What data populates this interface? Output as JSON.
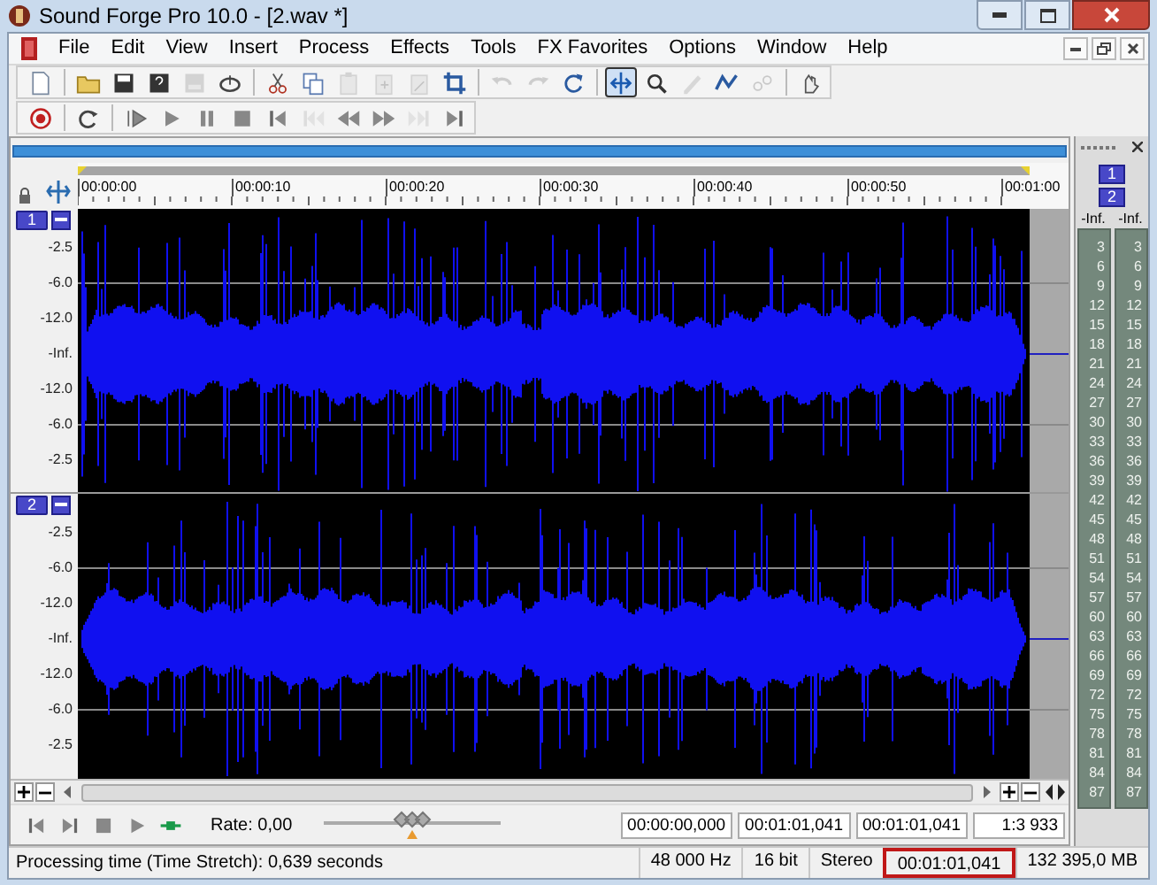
{
  "window": {
    "title": "Sound Forge Pro 10.0 - [2.wav *]"
  },
  "menu": [
    "File",
    "Edit",
    "View",
    "Insert",
    "Process",
    "Effects",
    "Tools",
    "FX Favorites",
    "Options",
    "Window",
    "Help"
  ],
  "toolbar_1": [
    [
      {
        "kind": "new",
        "disabled": false,
        "selected": false
      }
    ],
    [
      {
        "kind": "open",
        "disabled": false,
        "selected": false
      },
      {
        "kind": "save",
        "disabled": false,
        "selected": false
      },
      {
        "kind": "save_as",
        "disabled": false,
        "selected": false
      },
      {
        "kind": "render",
        "disabled": true,
        "selected": false
      },
      {
        "kind": "properties",
        "disabled": false,
        "selected": false
      }
    ],
    [
      {
        "kind": "cut",
        "disabled": false,
        "selected": false
      },
      {
        "kind": "copy",
        "disabled": false,
        "selected": false
      },
      {
        "kind": "paste",
        "disabled": true,
        "selected": false
      },
      {
        "kind": "mix",
        "disabled": true,
        "selected": false
      },
      {
        "kind": "crossfade",
        "disabled": true,
        "selected": false
      },
      {
        "kind": "trim",
        "disabled": false,
        "selected": false
      }
    ],
    [
      {
        "kind": "undo",
        "disabled": true,
        "selected": false
      },
      {
        "kind": "redo",
        "disabled": true,
        "selected": false
      },
      {
        "kind": "repeat",
        "disabled": false,
        "selected": false
      }
    ],
    [
      {
        "kind": "edit_tool",
        "disabled": false,
        "selected": true
      },
      {
        "kind": "magnify",
        "disabled": false,
        "selected": false
      },
      {
        "kind": "pencil",
        "disabled": true,
        "selected": false
      },
      {
        "kind": "envelope",
        "disabled": false,
        "selected": false
      },
      {
        "kind": "event",
        "disabled": true,
        "selected": false
      }
    ],
    [
      {
        "kind": "plugin",
        "disabled": false,
        "selected": false
      }
    ]
  ],
  "toolbar_2": [
    [
      {
        "kind": "record",
        "disabled": false
      }
    ],
    [
      {
        "kind": "loop",
        "disabled": false
      }
    ],
    [
      {
        "kind": "play_all",
        "disabled": false
      },
      {
        "kind": "play",
        "disabled": false
      },
      {
        "kind": "pause",
        "disabled": false
      },
      {
        "kind": "stop",
        "disabled": false
      },
      {
        "kind": "go_start",
        "disabled": false
      },
      {
        "kind": "prev",
        "disabled": true
      },
      {
        "kind": "rewind",
        "disabled": false
      },
      {
        "kind": "forward",
        "disabled": false
      },
      {
        "kind": "next",
        "disabled": true
      },
      {
        "kind": "go_end",
        "disabled": false
      }
    ]
  ],
  "ruler": {
    "labels": [
      "00:00:00",
      "00:00:10",
      "00:00:20",
      "00:00:30",
      "00:00:40",
      "00:00:50",
      "00:01:00"
    ]
  },
  "channels": [
    {
      "number": "1",
      "scale": [
        "-2.5",
        "-6.0",
        "-12.0",
        "-Inf.",
        "-12.0",
        "-6.0",
        "-2.5"
      ]
    },
    {
      "number": "2",
      "scale": [
        "-2.5",
        "-6.0",
        "-12.0",
        "-Inf.",
        "-12.0",
        "-6.0",
        "-2.5"
      ]
    }
  ],
  "meters": [
    {
      "number": "1",
      "peak": "-Inf.",
      "scale": [
        "3",
        "6",
        "9",
        "12",
        "15",
        "18",
        "21",
        "24",
        "27",
        "30",
        "33",
        "36",
        "39",
        "42",
        "45",
        "48",
        "51",
        "54",
        "57",
        "60",
        "63",
        "66",
        "69",
        "72",
        "75",
        "78",
        "81",
        "84",
        "87"
      ]
    },
    {
      "number": "2",
      "peak": "-Inf.",
      "scale": [
        "3",
        "6",
        "9",
        "12",
        "15",
        "18",
        "21",
        "24",
        "27",
        "30",
        "33",
        "36",
        "39",
        "42",
        "45",
        "48",
        "51",
        "54",
        "57",
        "60",
        "63",
        "66",
        "69",
        "72",
        "75",
        "78",
        "81",
        "84",
        "87"
      ]
    }
  ],
  "transport": {
    "rate": "Rate: 0,00",
    "rate_slider": {
      "level": 0.5
    }
  },
  "time_fields": [
    "00:00:00,000",
    "00:01:01,041",
    "00:01:01,041",
    "1:3 933"
  ],
  "status_bar": {
    "message": "Processing time (Time Stretch): 0,639 seconds",
    "fields": [
      {
        "text": "48 000 Hz",
        "highlighted": false
      },
      {
        "text": "16 bit",
        "highlighted": false
      },
      {
        "text": "Stereo",
        "highlighted": false
      },
      {
        "text": "00:01:01,041",
        "highlighted": true
      },
      {
        "text": "132 395,0 MB",
        "highlighted": false
      }
    ]
  }
}
